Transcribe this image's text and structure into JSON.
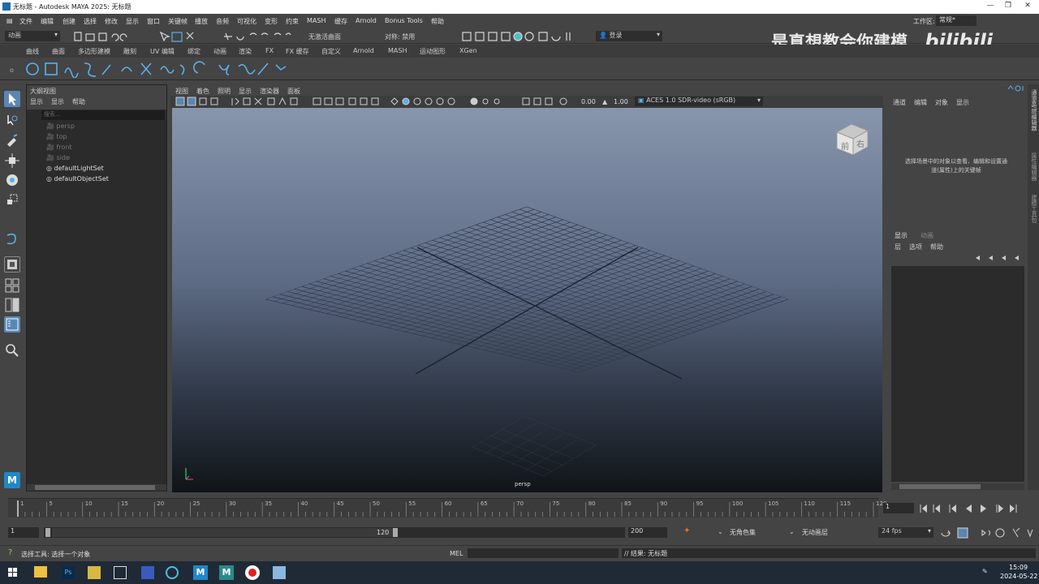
{
  "window": {
    "title": "无标题 - Autodesk MAYA 2025: 无标题",
    "minimize": "—",
    "restore": "❐",
    "close": "✕"
  },
  "menubar": {
    "items": [
      "文件",
      "编辑",
      "创建",
      "选择",
      "修改",
      "显示",
      "窗口",
      "关键帧",
      "播放",
      "音频",
      "可视化",
      "变形",
      "约束",
      "MASH",
      "缓存",
      "Arnold",
      "Bonus Tools",
      "帮助"
    ],
    "workspace_label": "工作区:",
    "workspace_value": "常规*"
  },
  "statusline": {
    "menuset": "动画",
    "surface_label": "无激活曲面",
    "symmetry_label": "对称: 禁用",
    "login": "登录"
  },
  "watermark": {
    "text": "是真想教会你建模",
    "logo": "bilibili"
  },
  "shelf": {
    "tabs": [
      "曲线",
      "曲面",
      "多边形建模",
      "雕刻",
      "UV 编辑",
      "绑定",
      "动画",
      "渲染",
      "FX",
      "FX 缓存",
      "自定义",
      "Arnold",
      "MASH",
      "运动图形",
      "XGen"
    ]
  },
  "outliner": {
    "title": "大纲视图",
    "menus": [
      "显示",
      "显示",
      "帮助"
    ],
    "search_placeholder": "搜索...",
    "items": [
      {
        "label": "persp",
        "dim": true
      },
      {
        "label": "top",
        "dim": true
      },
      {
        "label": "front",
        "dim": true
      },
      {
        "label": "side",
        "dim": true
      },
      {
        "label": "defaultLightSet",
        "dim": false
      },
      {
        "label": "defaultObjectSet",
        "dim": false
      }
    ]
  },
  "viewport": {
    "menus": [
      "视图",
      "着色",
      "照明",
      "显示",
      "渲染器",
      "面板"
    ],
    "exposure": "0.00",
    "gamma": "1.00",
    "colorspace": "ACES 1.0 SDR-video (sRGB)",
    "camera_label": "persp",
    "cube_front": "前",
    "cube_right": "右"
  },
  "channelbox": {
    "menus": [
      "通道",
      "编辑",
      "对象",
      "显示"
    ],
    "hint": "选择场景中的对象以查看、编辑和设置通道(属性)上的关键帧"
  },
  "layers": {
    "tabs": [
      "显示",
      "动画"
    ],
    "menus": [
      "层",
      "选项",
      "帮助"
    ]
  },
  "side_tabs": [
    "通道盒/层编辑器",
    "属性编辑器",
    "建模工具包"
  ],
  "timeline": {
    "ticks": [
      "1",
      "5",
      "10",
      "15",
      "20",
      "25",
      "30",
      "35",
      "40",
      "45",
      "50",
      "55",
      "60",
      "65",
      "70",
      "75",
      "80",
      "85",
      "90",
      "95",
      "100",
      "105",
      "110",
      "115",
      "120"
    ],
    "current_frame": "1"
  },
  "range": {
    "start": "1",
    "inner_start": "1",
    "inner_end": "120",
    "end": "200",
    "char_set": "无角色集",
    "anim_layer": "无动画层",
    "fps": "24 fps"
  },
  "cmd": {
    "help_line": "选择工具: 选择一个对象",
    "lang": "MEL",
    "result": "// 结果: 无标题"
  },
  "taskbar": {
    "time": "15:09",
    "date": "2024-05-22",
    "ps_label": "Ps"
  }
}
